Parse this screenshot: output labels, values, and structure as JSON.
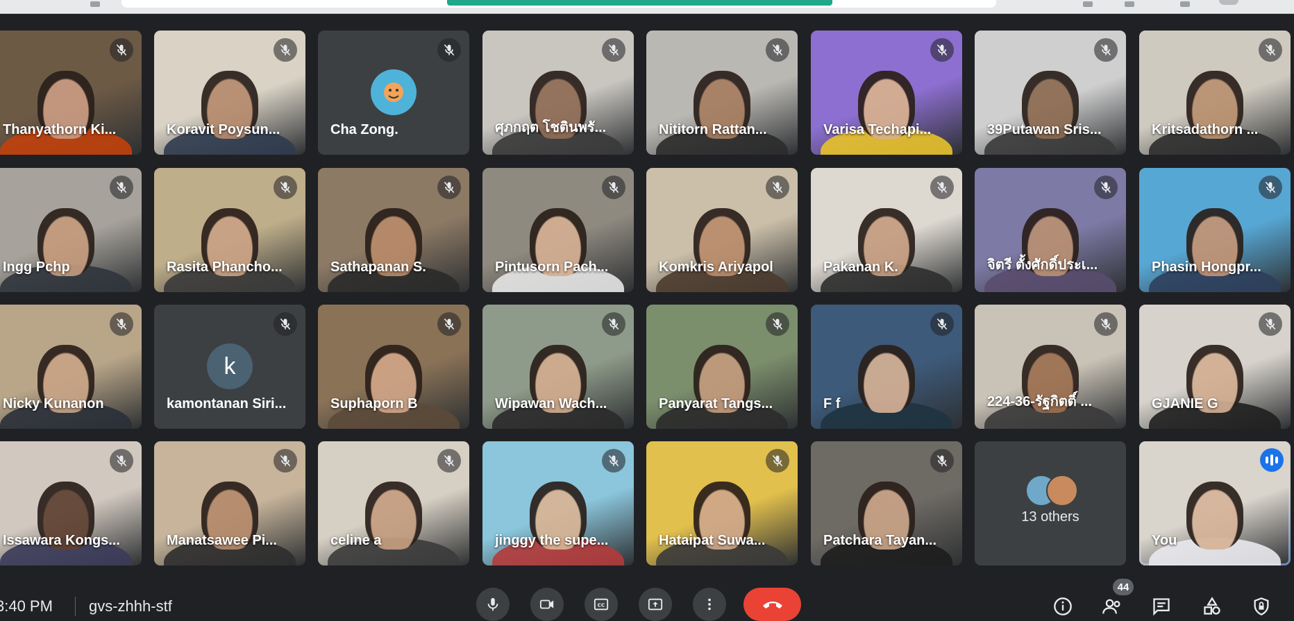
{
  "meeting": {
    "time": "3:40 PM",
    "code": "gvs-zhhh-stf",
    "participant_count": "44"
  },
  "participants": [
    {
      "name": "Thanyathorn Ki...",
      "muted": true,
      "bg": "#6d5a45",
      "skin": "#c99b82",
      "shirt": "#c2410c"
    },
    {
      "name": "Koravit Poysun...",
      "muted": true,
      "bg": "#d9d2c5",
      "skin": "#b58a6d",
      "shirt": "#2f3b4f"
    },
    {
      "name": "Cha Zong.",
      "muted": true,
      "avatar": "picture",
      "avatar_color": "#4fb3d9"
    },
    {
      "name": "ศุภกฤต โชตินพรั...",
      "muted": true,
      "bg": "#c9c6c0",
      "skin": "#8f6c55",
      "shirt": "#3a3a3a"
    },
    {
      "name": "Nititorn Rattan...",
      "muted": true,
      "bg": "#bab8b3",
      "skin": "#a67d60",
      "shirt": "#2b2b2b"
    },
    {
      "name": "Varisa Techapi...",
      "muted": true,
      "bg": "#8d6fd1",
      "skin": "#d8b08e",
      "shirt": "#e8c22a"
    },
    {
      "name": "39Putawan Sris...",
      "muted": true,
      "bg": "#cfcfcf",
      "skin": "#8c6a50",
      "shirt": "#3a3a3a"
    },
    {
      "name": "Kritsadathorn ...",
      "muted": true,
      "bg": "#cfcac0",
      "skin": "#b8906f",
      "shirt": "#2c2c2c"
    },
    {
      "name": "Ingg Pchp",
      "muted": true,
      "bg": "#a7a39c",
      "skin": "#c49a7c",
      "shirt": "#30353d"
    },
    {
      "name": "Rasita Phancho...",
      "muted": true,
      "bg": "#bfae8a",
      "skin": "#c9a183",
      "shirt": "#3a3a3a"
    },
    {
      "name": "Sathapanan S.",
      "muted": true,
      "bg": "#8c7a65",
      "skin": "#b88a69",
      "shirt": "#2a2a2a"
    },
    {
      "name": "Pintusorn Pach...",
      "muted": true,
      "bg": "#8f8a80",
      "skin": "#d3ae92",
      "shirt": "#e6e6e6"
    },
    {
      "name": "Komkris Ariyapol",
      "muted": true,
      "bg": "#cbbfa9",
      "skin": "#b98c6b",
      "shirt": "#4a3b2e"
    },
    {
      "name": "Pakanan K.",
      "muted": true,
      "bg": "#ddd8d0",
      "skin": "#c49c80",
      "shirt": "#2d2d2d"
    },
    {
      "name": "จิตรี ตั้งศักดิ์ประเ...",
      "muted": true,
      "bg": "#7e7aa6",
      "skin": "#b98f72",
      "shirt": "#5a4d6e"
    },
    {
      "name": "Phasin Hongpr...",
      "muted": true,
      "bg": "#57a7d4",
      "skin": "#c29373",
      "shirt": "#2d3f5c"
    },
    {
      "name": "Nicky Kunanon",
      "muted": true,
      "bg": "#b9a689",
      "skin": "#c7a385",
      "shirt": "#2a3038"
    },
    {
      "name": "kamontanan Siri...",
      "muted": true,
      "avatar": "k",
      "avatar_color": "#4a6272"
    },
    {
      "name": "Suphaporn B",
      "muted": true,
      "bg": "#8a7257",
      "skin": "#cfa486",
      "shirt": "#5c4a3a"
    },
    {
      "name": "Wipawan Wach...",
      "muted": true,
      "bg": "#8f9b8a",
      "skin": "#d1ab8d",
      "shirt": "#2a2a2a"
    },
    {
      "name": "Panyarat Tangs...",
      "muted": true,
      "bg": "#7c8f6d",
      "skin": "#c29a7c",
      "shirt": "#2b2b2b"
    },
    {
      "name": "F f",
      "muted": true,
      "bg": "#3d5a7a",
      "skin": "#d4b094",
      "shirt": "#1f3340"
    },
    {
      "name": "224-36-รัฐกิตติ์ ...",
      "muted": true,
      "bg": "#c9c2b6",
      "skin": "#9c6f50",
      "shirt": "#3a3a3a"
    },
    {
      "name": "GJANIE G",
      "muted": true,
      "bg": "#d7d3cc",
      "skin": "#d2ae92",
      "shirt": "#1f1f1f"
    },
    {
      "name": "Issawara Kongs...",
      "muted": true,
      "bg": "#d1c8bf",
      "skin": "#5e4030",
      "shirt": "#3b3b5a"
    },
    {
      "name": "Manatsawee Pi...",
      "muted": true,
      "bg": "#c7b49b",
      "skin": "#b58a6b",
      "shirt": "#2e2e2e"
    },
    {
      "name": "celine a",
      "muted": true,
      "bg": "#d6cfc3",
      "skin": "#c49d80",
      "shirt": "#3b3b3b"
    },
    {
      "name": "jinggy the supe...",
      "muted": true,
      "bg": "#8bc6dc",
      "skin": "#d8b494",
      "shirt": "#b43b3b"
    },
    {
      "name": "Hataipat Suwa...",
      "muted": true,
      "bg": "#e2c04d",
      "skin": "#cfa789",
      "shirt": "#3a3a3a"
    },
    {
      "name": "Patchara Tayan...",
      "muted": true,
      "bg": "#6e6a64",
      "skin": "#c8a386",
      "shirt": "#1d1d1d"
    },
    {
      "name": "13 others",
      "others": true,
      "mini_colors": [
        "#6fa8c8",
        "#c98a5e"
      ]
    },
    {
      "name": "You",
      "self": true,
      "speaking": true,
      "bg": "#d9d4cc",
      "skin": "#d6b398",
      "shirt": "#e9e9ee"
    }
  ]
}
